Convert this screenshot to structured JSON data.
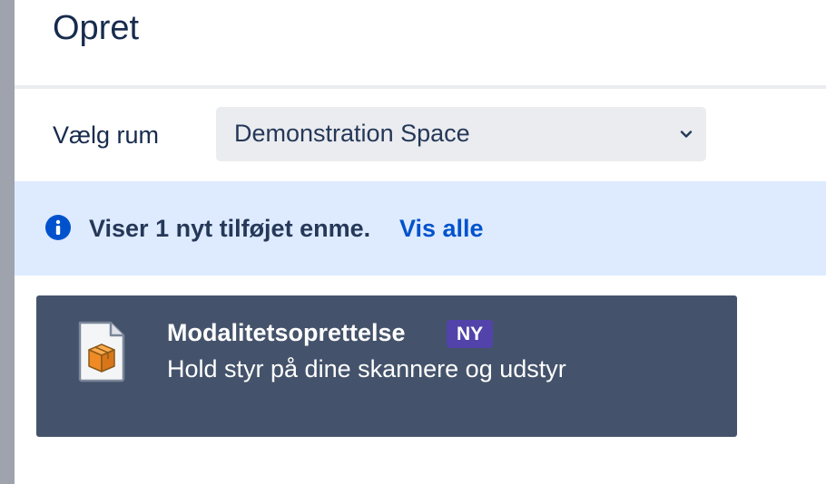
{
  "dialog": {
    "title": "Opret"
  },
  "space_picker": {
    "label": "Vælg rum",
    "selected": "Demonstration Space"
  },
  "info_banner": {
    "message": "Viser 1 nyt tilføjet enme.",
    "link": "Vis alle"
  },
  "items": [
    {
      "title": "Modalitetsoprettelse",
      "badge": "NY",
      "description": "Hold styr på dine skannere og udstyr",
      "icon": "package-file-icon"
    }
  ],
  "colors": {
    "info_background": "#deebff",
    "info_icon": "#0052cc",
    "link": "#0052cc",
    "card_background": "#44536b",
    "badge_background": "#5243aa",
    "select_background": "#ebecf0"
  }
}
